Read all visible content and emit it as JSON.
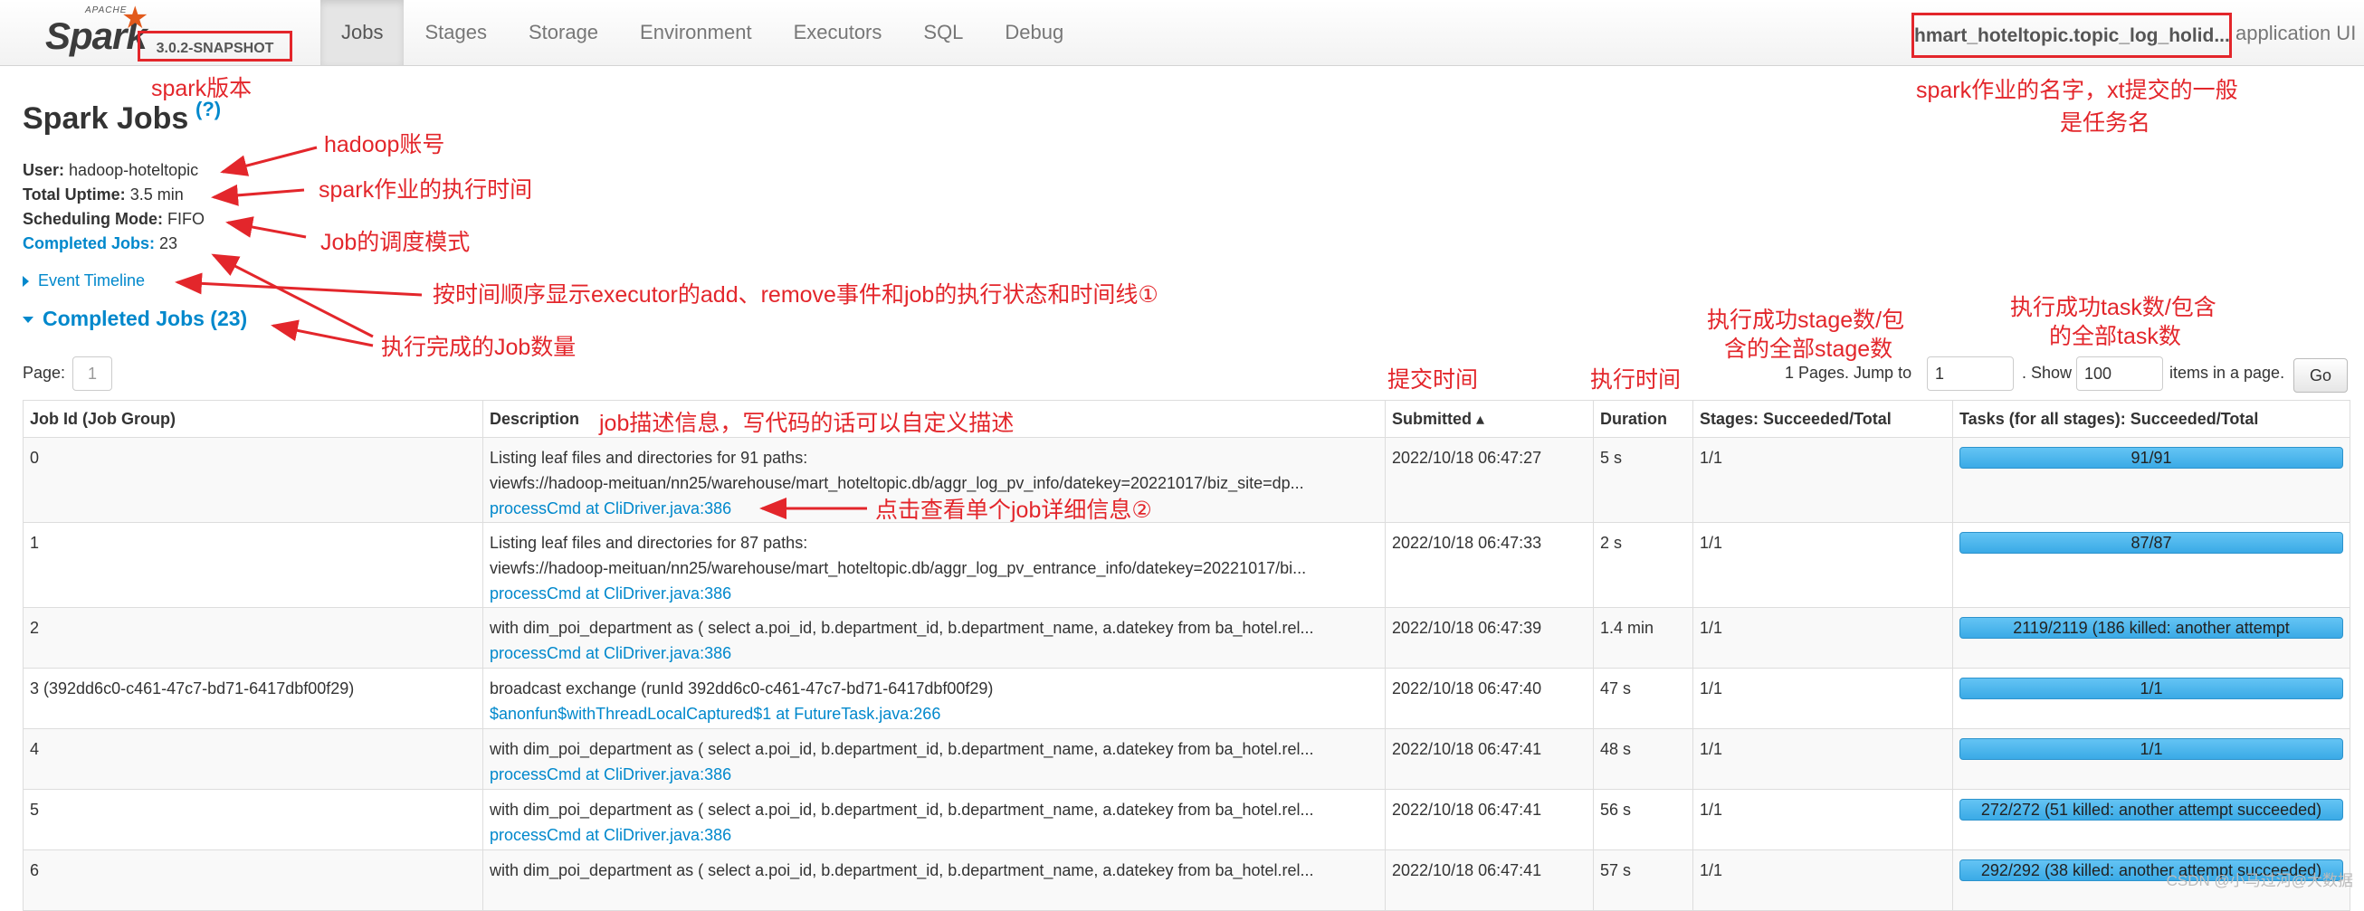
{
  "navbar": {
    "logo_apache": "APACHE",
    "logo_text": "Spark",
    "version": "3.0.2-SNAPSHOT",
    "tabs": [
      {
        "label": "Jobs",
        "active": true
      },
      {
        "label": "Stages",
        "active": false
      },
      {
        "label": "Storage",
        "active": false
      },
      {
        "label": "Environment",
        "active": false
      },
      {
        "label": "Executors",
        "active": false
      },
      {
        "label": "SQL",
        "active": false
      },
      {
        "label": "Debug",
        "active": false
      }
    ],
    "app_name": "hmart_hoteltopic.topic_log_holid...",
    "app_ui_label": "application UI"
  },
  "header": {
    "title": "Spark Jobs",
    "help": "(?)"
  },
  "summary": {
    "user_label": "User:",
    "user_value": "hadoop-hoteltopic",
    "uptime_label": "Total Uptime:",
    "uptime_value": "3.5 min",
    "mode_label": "Scheduling Mode:",
    "mode_value": "FIFO",
    "completed_label": "Completed Jobs:",
    "completed_value": "23"
  },
  "event_timeline": "Event Timeline",
  "completed_section": "Completed Jobs (23)",
  "pagination": {
    "page_label": "Page:",
    "page_value": "1",
    "pages_text": "1 Pages. Jump to",
    "jump_value": "1",
    "show_label": ". Show",
    "show_value": "100",
    "items_label": "items in a page.",
    "go_label": "Go"
  },
  "table": {
    "headers": [
      "Job Id (Job Group)",
      "Description",
      "Submitted ▴",
      "Duration",
      "Stages: Succeeded/Total",
      "Tasks (for all stages): Succeeded/Total"
    ],
    "rows": [
      {
        "id": "0",
        "desc1": "Listing leaf files and directories for 91 paths:",
        "desc2": "viewfs://hadoop-meituan/nn25/warehouse/mart_hoteltopic.db/aggr_log_pv_info/datekey=20221017/biz_site=dp...",
        "link": "processCmd at CliDriver.java:386",
        "submitted": "2022/10/18 06:47:27",
        "duration": "5 s",
        "stages": "1/1",
        "tasks": "91/91",
        "tasks_progress": 1.0
      },
      {
        "id": "1",
        "desc1": "Listing leaf files and directories for 87 paths:",
        "desc2": "viewfs://hadoop-meituan/nn25/warehouse/mart_hoteltopic.db/aggr_log_pv_entrance_info/datekey=20221017/bi...",
        "link": "processCmd at CliDriver.java:386",
        "submitted": "2022/10/18 06:47:33",
        "duration": "2 s",
        "stages": "1/1",
        "tasks": "87/87",
        "tasks_progress": 1.0
      },
      {
        "id": "2",
        "desc1": "with dim_poi_department as ( select a.poi_id, b.department_id, b.department_name, a.datekey from ba_hotel.rel...",
        "desc2": "",
        "link": "processCmd at CliDriver.java:386",
        "submitted": "2022/10/18 06:47:39",
        "duration": "1.4 min",
        "stages": "1/1",
        "tasks": "2119/2119 (186 killed: another attempt",
        "tasks_progress": 1.0
      },
      {
        "id": "3 (392dd6c0-c461-47c7-bd71-6417dbf00f29)",
        "desc1": "broadcast exchange (runId 392dd6c0-c461-47c7-bd71-6417dbf00f29)",
        "desc2": "",
        "link": "$anonfun$withThreadLocalCaptured$1 at FutureTask.java:266",
        "submitted": "2022/10/18 06:47:40",
        "duration": "47 s",
        "stages": "1/1",
        "tasks": "1/1",
        "tasks_progress": 1.0
      },
      {
        "id": "4",
        "desc1": "with dim_poi_department as ( select a.poi_id, b.department_id, b.department_name, a.datekey from ba_hotel.rel...",
        "desc2": "",
        "link": "processCmd at CliDriver.java:386",
        "submitted": "2022/10/18 06:47:41",
        "duration": "48 s",
        "stages": "1/1",
        "tasks": "1/1",
        "tasks_progress": 1.0
      },
      {
        "id": "5",
        "desc1": "with dim_poi_department as ( select a.poi_id, b.department_id, b.department_name, a.datekey from ba_hotel.rel...",
        "desc2": "",
        "link": "processCmd at CliDriver.java:386",
        "submitted": "2022/10/18 06:47:41",
        "duration": "56 s",
        "stages": "1/1",
        "tasks": "272/272 (51 killed: another attempt succeeded)",
        "tasks_progress": 1.0
      },
      {
        "id": "6",
        "desc1": "with dim_poi_department as ( select a.poi_id, b.department_id, b.department_name, a.datekey from ba_hotel.rel...",
        "desc2": "",
        "link": "",
        "submitted": "2022/10/18 06:47:41",
        "duration": "57 s",
        "stages": "1/1",
        "tasks": "292/292 (38 killed: another attempt succeeded)",
        "tasks_progress": 1.0
      }
    ]
  },
  "annotations": {
    "version": "spark版本",
    "app_name_line1": "spark作业的名字，xt提交的一般",
    "app_name_line2": "是任务名",
    "user": "hadoop账号",
    "uptime": "spark作业的执行时间",
    "mode": "Job的调度模式",
    "timeline": "按时间顺序显示executor的add、remove事件和job的执行状态和时间线①",
    "completed": "执行完成的Job数量",
    "stages_line1": "执行成功stage数/包",
    "stages_line2": "含的全部stage数",
    "tasks_line1": "执行成功task数/包含",
    "tasks_line2": "的全部task数",
    "submitted": "提交时间",
    "duration": "执行时间",
    "description": "job描述信息，写代码的话可以自定义描述",
    "detail": "点击查看单个job详细信息②"
  },
  "footer": {
    "csdn": "CSDN @小马过河@大数据"
  },
  "colors": {
    "accent_link": "#0088cc",
    "annotation_red": "#e3262b",
    "progress_blue": "#3aaae6"
  }
}
